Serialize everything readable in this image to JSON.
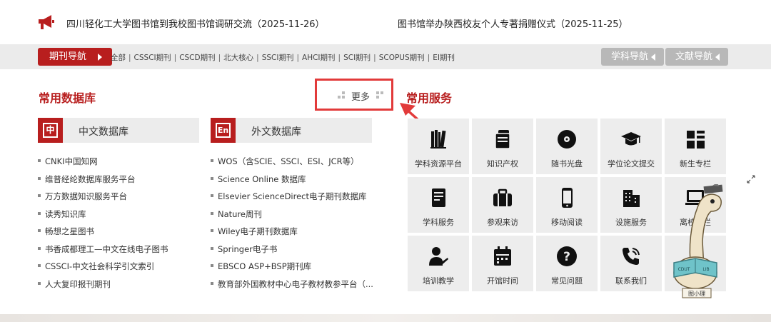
{
  "news": {
    "items": [
      "四川轻化工大学图书馆到我校图书馆调研交流（2025-11-26）",
      "图书馆举办陕西校友个人专著捐赠仪式（2025-11-25）"
    ]
  },
  "nav": {
    "journal_nav_label": "期刊导航",
    "links": [
      "全部",
      "CSSCI期刊",
      "CSCD期刊",
      "北大核心",
      "SSCI期刊",
      "AHCI期刊",
      "SCI期刊",
      "SCOPUS期刊",
      "EI期刊"
    ],
    "subject_nav_label": "学科导航",
    "doc_nav_label": "文献导航"
  },
  "databases": {
    "title": "常用数据库",
    "more_label": "更多",
    "chinese": {
      "icon_char": "中",
      "title": "中文数据库",
      "items": [
        "CNKI中国知网",
        "维普经纶数据库服务平台",
        "万方数据知识服务平台",
        "读秀知识库",
        "畅想之星图书",
        "书香成都理工—中文在线电子图书",
        "CSSCI-中文社会科学引文索引",
        "人大复印报刊期刊"
      ]
    },
    "foreign": {
      "icon_char": "En",
      "title": "外文数据库",
      "items": [
        "WOS（含SCIE、SSCI、ESI、JCR等）",
        "Science Online 数据库",
        "Elsevier ScienceDirect电子期刊数据库",
        "Nature周刊",
        "Wiley电子期刊数据库",
        "Springer电子书",
        "EBSCO ASP+BSP期刊库",
        "教育部外国教材中心电子教材教参平台（..."
      ]
    }
  },
  "services": {
    "title": "常用服务",
    "tiles": [
      {
        "label": "学科资源平台",
        "icon": "books-icon"
      },
      {
        "label": "知识产权",
        "icon": "document-stack-icon"
      },
      {
        "label": "随书光盘",
        "icon": "disc-icon"
      },
      {
        "label": "学位论文提交",
        "icon": "graduation-cap-icon"
      },
      {
        "label": "新生专栏",
        "icon": "grid-icon"
      },
      {
        "label": "学科服务",
        "icon": "book-icon"
      },
      {
        "label": "参观来访",
        "icon": "briefcase-icon"
      },
      {
        "label": "移动阅读",
        "icon": "phone-icon"
      },
      {
        "label": "设施服务",
        "icon": "building-icon"
      },
      {
        "label": "离校专栏",
        "icon": "laptop-icon"
      },
      {
        "label": "培训教学",
        "icon": "teacher-icon"
      },
      {
        "label": "开馆时间",
        "icon": "calendar-icon"
      },
      {
        "label": "常见问题",
        "icon": "question-icon"
      },
      {
        "label": "联系我们",
        "icon": "phone-call-icon"
      },
      {
        "label": "",
        "icon": ""
      }
    ]
  },
  "mascot": {
    "book_text": "CDUT LIB",
    "name_tag": "图小理"
  },
  "colors": {
    "brand_red": "#b81e1e",
    "highlight_red": "#e23a3a",
    "tile_gray": "#ededed",
    "nav_gray": "#ebebeb",
    "button_gray": "#b8b8b8"
  }
}
